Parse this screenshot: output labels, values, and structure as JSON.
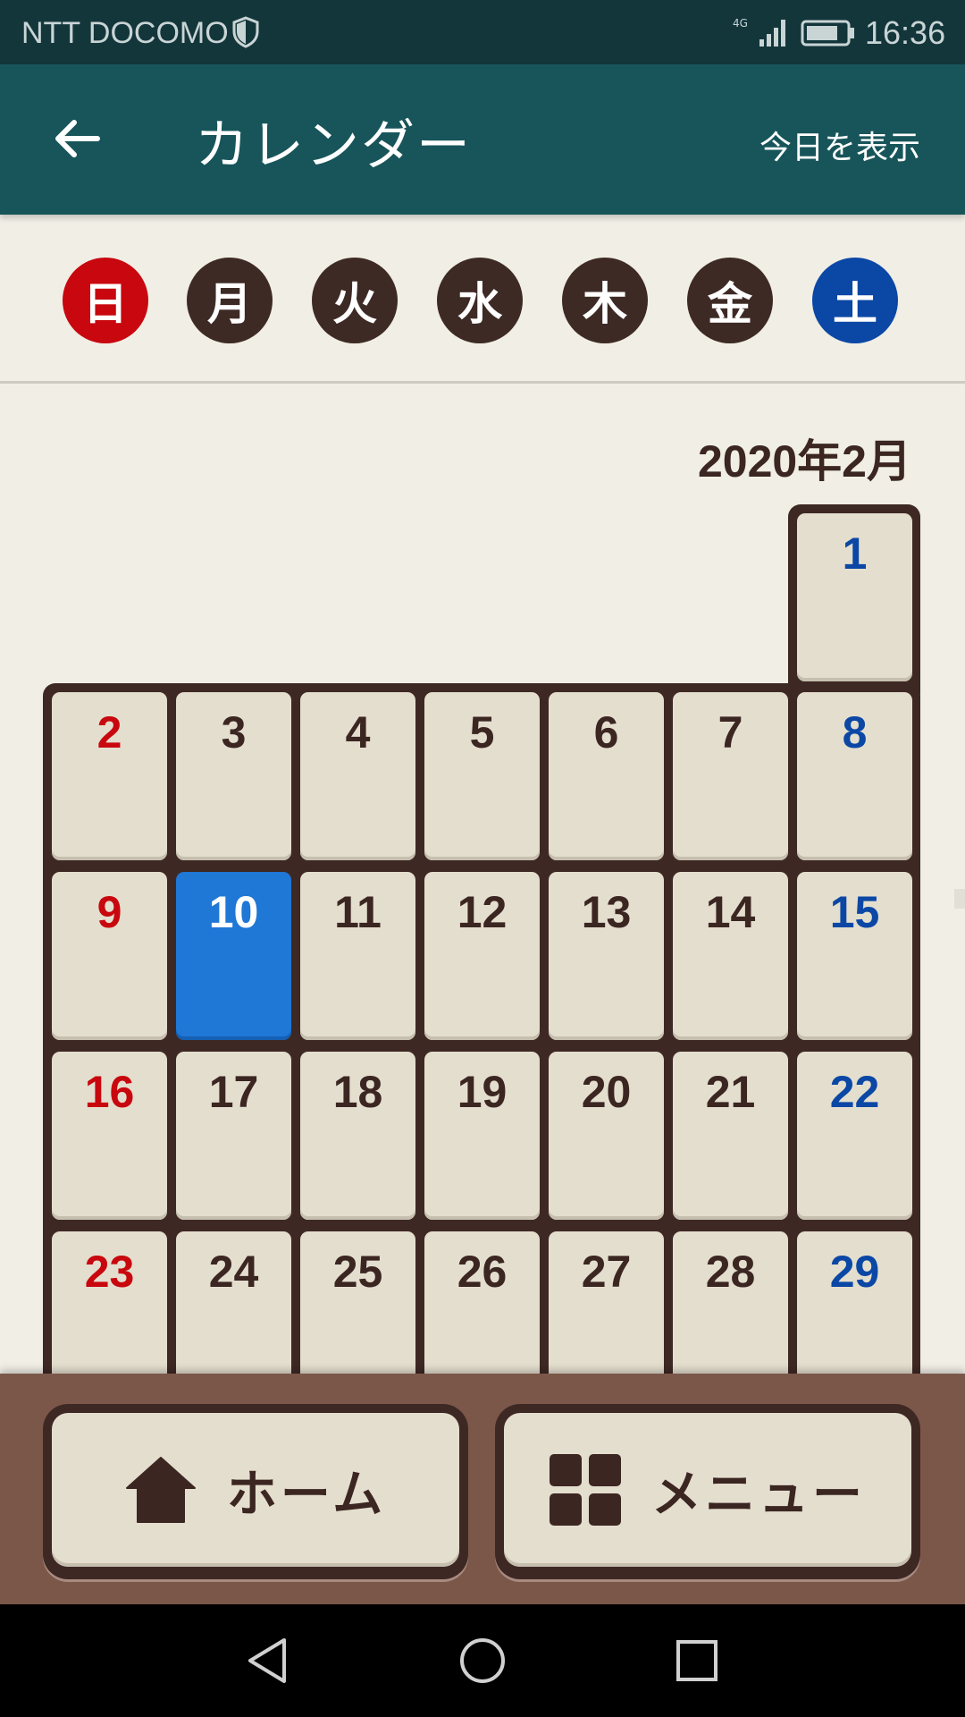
{
  "status_bar": {
    "carrier": "NTT DOCOMO",
    "network": "4G",
    "time": "16:36"
  },
  "app_bar": {
    "title": "カレンダー",
    "today_button": "今日を表示"
  },
  "weekdays": [
    "日",
    "月",
    "火",
    "水",
    "木",
    "金",
    "土"
  ],
  "calendar": {
    "month_label": "2020年2月",
    "first_row": [
      "1"
    ],
    "weeks": [
      [
        "2",
        "3",
        "4",
        "5",
        "6",
        "7",
        "8"
      ],
      [
        "9",
        "10",
        "11",
        "12",
        "13",
        "14",
        "15"
      ],
      [
        "16",
        "17",
        "18",
        "19",
        "20",
        "21",
        "22"
      ],
      [
        "23",
        "24",
        "25",
        "26",
        "27",
        "28",
        "29"
      ]
    ],
    "selected_day": "10",
    "colors": {
      "sunday": "#c8070e",
      "saturday": "#0b47a5",
      "selected": "#1f77d6"
    }
  },
  "bottom_bar": {
    "home_label": "ホーム",
    "menu_label": "メニュー"
  },
  "icons": [
    "back-arrow-icon",
    "home-icon",
    "grid-menu-icon",
    "nav-back-icon",
    "nav-home-icon",
    "nav-recents-icon"
  ]
}
